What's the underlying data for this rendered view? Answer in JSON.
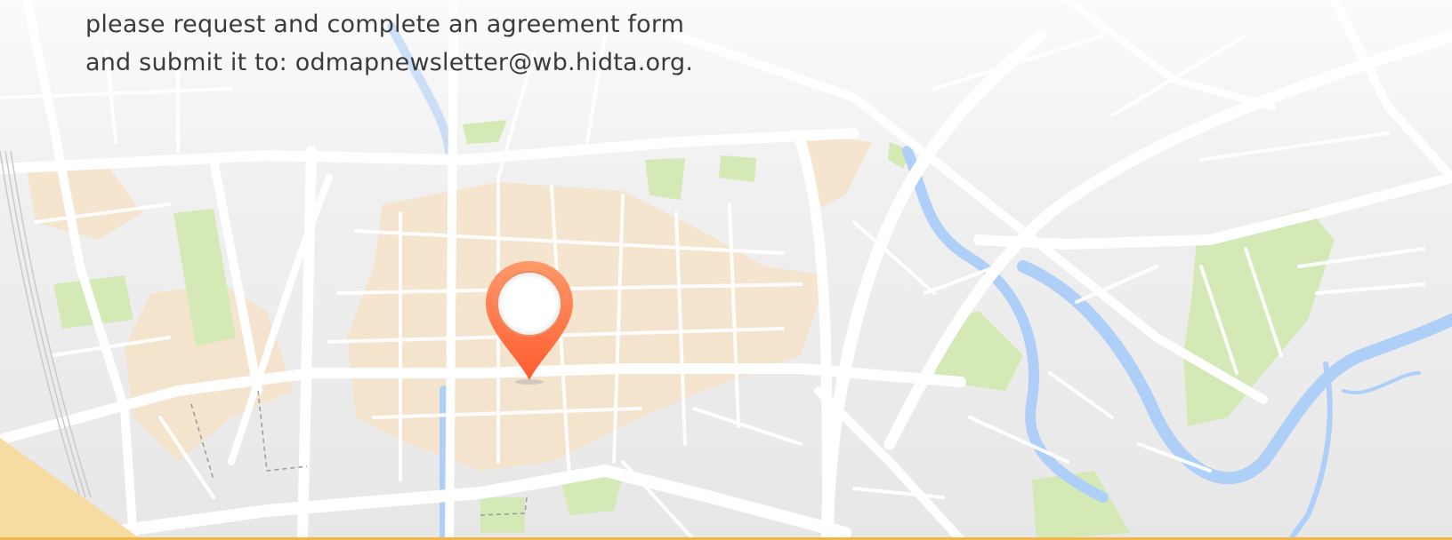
{
  "body_text": {
    "line_1": "please request and complete an agreement form",
    "line_2": "and submit it to: odmapnewsletter@wb.hidta.org."
  },
  "icons": {
    "map": "city-street-map-icon",
    "pin": "location-pin-icon"
  },
  "colors": {
    "pin": "#ff6f3d",
    "pin_highlight": "#ff9a6a",
    "water": "#aecff7",
    "park": "#d4e9b6",
    "district": "#f6e3c9",
    "road": "#ffffff",
    "accent_line": "#f0b64a",
    "corner": "#f7dca2"
  }
}
